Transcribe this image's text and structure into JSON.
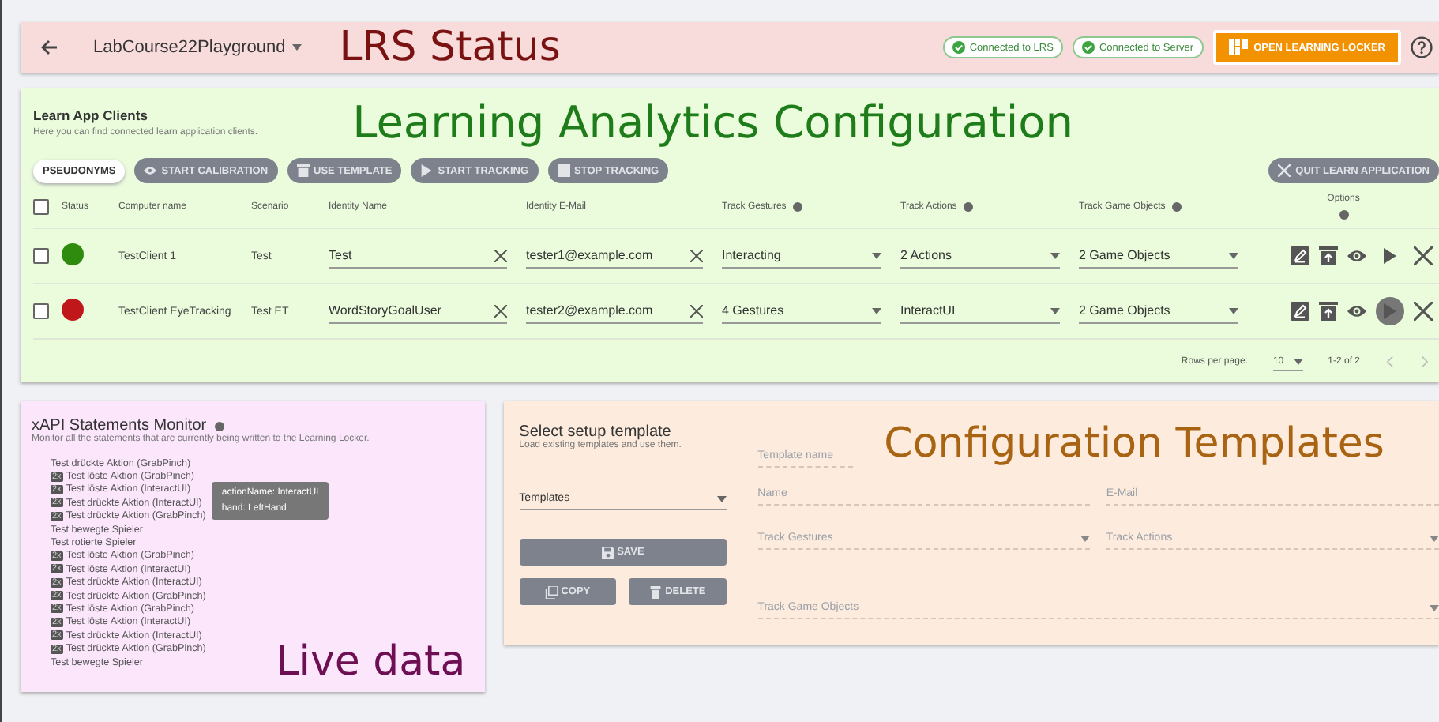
{
  "header": {
    "project": "LabCourse22Playground",
    "annotation": "LRS Status",
    "badges": [
      "Connected to LRS",
      "Connected to Server"
    ],
    "open_button": "OPEN LEARNING LOCKER"
  },
  "clients": {
    "title": "Learn App Clients",
    "subtitle": "Here you can find connected learn application clients.",
    "annotation": "Learning Analytics Configuration",
    "toolbar": [
      {
        "label": "PSEUDONYMS",
        "disabled": false
      },
      {
        "label": "START CALIBRATION",
        "disabled": true
      },
      {
        "label": "USE TEMPLATE",
        "disabled": true
      },
      {
        "label": "START TRACKING",
        "disabled": true
      },
      {
        "label": "STOP TRACKING",
        "disabled": true
      }
    ],
    "select_all_checked": false,
    "quit_button": {
      "label": "QUIT LEARN APPLICATION",
      "disabled": true
    },
    "columns": [
      "Status",
      "Computer name",
      "Scenario",
      "Identity Name",
      "Identity E-Mail",
      "Track Gestures",
      "Track Actions",
      "Track Game Objects",
      "Options"
    ],
    "rows": [
      {
        "checked": false,
        "color": "#2e8b0e",
        "computer": "TestClient 1",
        "scenario": "Test",
        "identity_name": "Test",
        "email": "tester1@example.com",
        "gestures": "Interacting",
        "actions": "2 Actions",
        "objects": "2 Game Objects",
        "play_hovered": false
      },
      {
        "checked": false,
        "color": "#c0171b",
        "computer": "TestClient EyeTracking",
        "scenario": "Test ET",
        "identity_name": "WordStoryGoalUser",
        "email": "tester2@example.com",
        "gestures": "4 Gestures",
        "actions": "InteractUI",
        "objects": "2 Game Objects",
        "play_hovered": true
      }
    ],
    "footer": {
      "rows_per_page_label": "Rows per page:",
      "rows_per_page": "10",
      "range": "1-2 of 2"
    }
  },
  "monitor": {
    "title": "xAPI Statements Monitor",
    "subtitle": "Monitor all the statements that are currently being written to the Learning Locker.",
    "annotation": "Live data",
    "entries": [
      {
        "text": "Test drückte Aktion (GrabPinch)"
      },
      {
        "count": "2x",
        "text": "Test löste Aktion (GrabPinch)"
      },
      {
        "count": "2x",
        "text": "Test löste Aktion (InteractUI)"
      },
      {
        "count": "2x",
        "text": "Test drückte Aktion (InteractUI)"
      },
      {
        "count": "2x",
        "text": "Test drückte Aktion (GrabPinch)"
      },
      {
        "text": "Test bewegte Spieler"
      },
      {
        "text": "Test rotierte Spieler"
      },
      {
        "count": "2x",
        "text": "Test löste Aktion (GrabPinch)"
      },
      {
        "count": "2x",
        "text": "Test löste Aktion (InteractUI)"
      },
      {
        "count": "2x",
        "text": "Test drückte Aktion (InteractUI)"
      },
      {
        "count": "2x",
        "text": "Test drückte Aktion (GrabPinch)"
      },
      {
        "count": "2x",
        "text": "Test löste Aktion (GrabPinch)"
      },
      {
        "count": "2x",
        "text": "Test löste Aktion (InteractUI)"
      },
      {
        "count": "2x",
        "text": "Test drückte Aktion (InteractUI)"
      },
      {
        "count": "2x",
        "text": "Test drückte Aktion (GrabPinch)"
      },
      {
        "text": "Test bewegte Spieler"
      }
    ],
    "tooltip": [
      "actionName: InteractUI",
      "hand: LeftHand"
    ]
  },
  "templates": {
    "title": "Select setup template",
    "subtitle": "Load existing templates and use them.",
    "annotation": "Configuration Templates",
    "select": {
      "placeholder": "Templates"
    },
    "buttons": [
      {
        "label": "SAVE",
        "disabled": true
      },
      {
        "label": "COPY",
        "disabled": true
      },
      {
        "label": "DELETE",
        "disabled": true
      }
    ],
    "fields": [
      {
        "placeholder": "Template name",
        "kind": "text"
      },
      {
        "placeholder": "Name",
        "kind": "text"
      },
      {
        "placeholder": "E-Mail",
        "kind": "text"
      },
      {
        "placeholder": "Track Gestures",
        "kind": "select"
      },
      {
        "placeholder": "Track Actions",
        "kind": "select"
      },
      {
        "placeholder": "Track Game Objects",
        "kind": "select"
      }
    ]
  }
}
